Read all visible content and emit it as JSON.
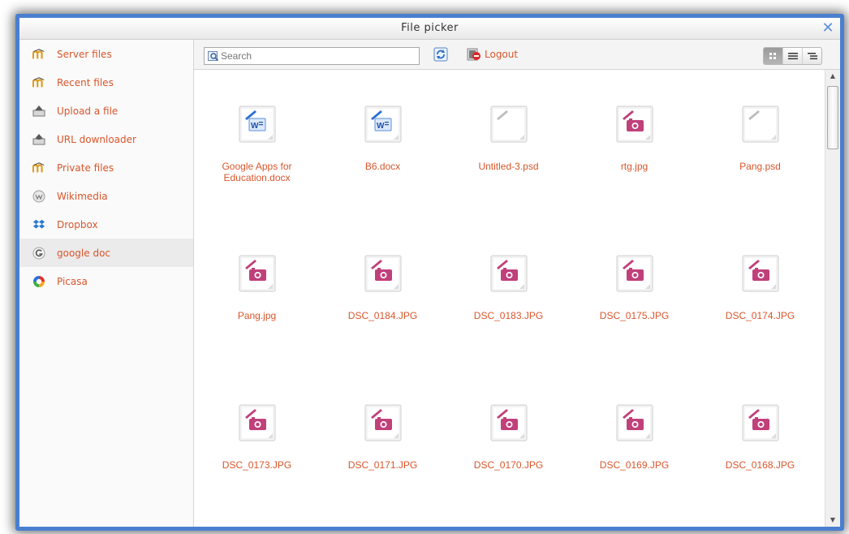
{
  "window": {
    "title": "File picker",
    "close_glyph": "✕"
  },
  "sidebar": {
    "items": [
      {
        "label": "Server files",
        "icon": "moodle-icon"
      },
      {
        "label": "Recent files",
        "icon": "moodle-icon"
      },
      {
        "label": "Upload a file",
        "icon": "upload-icon"
      },
      {
        "label": "URL downloader",
        "icon": "url-download-icon"
      },
      {
        "label": "Private files",
        "icon": "moodle-icon"
      },
      {
        "label": "Wikimedia",
        "icon": "wikimedia-icon"
      },
      {
        "label": "Dropbox",
        "icon": "dropbox-icon"
      },
      {
        "label": "google doc",
        "icon": "google-icon",
        "active": true
      },
      {
        "label": "Picasa",
        "icon": "picasa-icon"
      }
    ]
  },
  "toolbar": {
    "search_placeholder": "Search",
    "logout_label": "Logout",
    "views": [
      "icons-view",
      "list-view",
      "tree-view"
    ],
    "active_view": "icons-view"
  },
  "files": [
    {
      "name": "Google Apps for Education.docx",
      "type": "docx"
    },
    {
      "name": "B6.docx",
      "type": "docx"
    },
    {
      "name": "Untitled-3.psd",
      "type": "generic"
    },
    {
      "name": "rtg.jpg",
      "type": "image"
    },
    {
      "name": "Pang.psd",
      "type": "generic"
    },
    {
      "name": "Pang.jpg",
      "type": "image"
    },
    {
      "name": "DSC_0184.JPG",
      "type": "image"
    },
    {
      "name": "DSC_0183.JPG",
      "type": "image"
    },
    {
      "name": "DSC_0175.JPG",
      "type": "image"
    },
    {
      "name": "DSC_0174.JPG",
      "type": "image"
    },
    {
      "name": "DSC_0173.JPG",
      "type": "image"
    },
    {
      "name": "DSC_0171.JPG",
      "type": "image"
    },
    {
      "name": "DSC_0170.JPG",
      "type": "image"
    },
    {
      "name": "DSC_0169.JPG",
      "type": "image"
    },
    {
      "name": "DSC_0168.JPG",
      "type": "image"
    }
  ],
  "colors": {
    "accent": "#d9562b",
    "frame": "#4a7fcf",
    "image_icon": "#c0407a",
    "docx_icon": "#2b6fd6"
  }
}
